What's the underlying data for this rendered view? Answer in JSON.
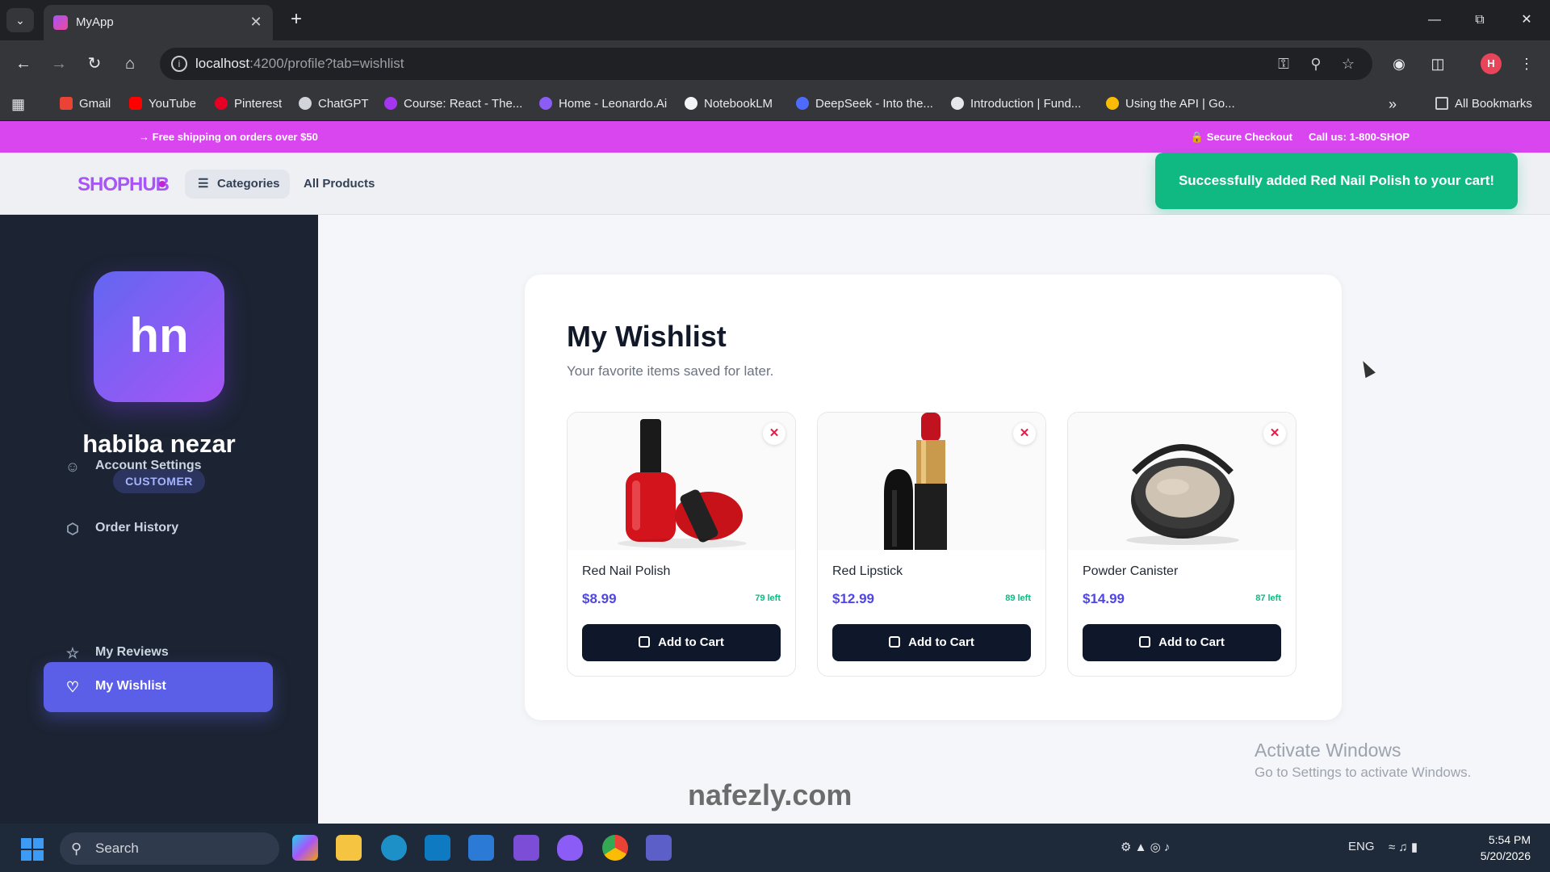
{
  "browser": {
    "tab_title": "MyApp",
    "new_tab": "+",
    "url_host": "localhost",
    "url_rest": ":4200/profile?tab=wishlist",
    "bookmarks": [
      "Gmail",
      "YouTube",
      "Pinterest",
      "ChatGPT",
      "Course: React - The...",
      "Home - Leonardo.Ai",
      "NotebookLM",
      "DeepSeek - Into the...",
      "Introduction | Fund...",
      "Using the API | Go..."
    ],
    "all_bookmarks": "All Bookmarks",
    "profile_initial": "H"
  },
  "promo": {
    "shipping": "Free shipping on orders over $50",
    "secure": "Secure Checkout",
    "call": "Call us: 1-800-SHOP"
  },
  "header": {
    "logo": "SHOPHUB",
    "categories": "Categories",
    "all_products": "All Products"
  },
  "toast": "Successfully added Red Nail Polish to your cart!",
  "profile": {
    "initials": "hn",
    "name": "habiba nezar",
    "role": "CUSTOMER",
    "nav": [
      {
        "label": "Account Settings",
        "icon": "user-icon"
      },
      {
        "label": "Order History",
        "icon": "box-icon"
      },
      {
        "label": "My Wishlist",
        "icon": "heart-icon",
        "active": true
      },
      {
        "label": "My Reviews",
        "icon": "star-icon"
      }
    ]
  },
  "wishlist": {
    "title": "My Wishlist",
    "subtitle": "Your favorite items saved for later.",
    "items": [
      {
        "name": "Red Nail Polish",
        "price": "$8.99",
        "stock": "79 left",
        "button": "Add to Cart"
      },
      {
        "name": "Red Lipstick",
        "price": "$12.99",
        "stock": "89 left",
        "button": "Add to Cart"
      },
      {
        "name": "Powder Canister",
        "price": "$14.99",
        "stock": "87 left",
        "button": "Add to Cart"
      }
    ]
  },
  "overlay": {
    "activate_title": "Activate Windows",
    "activate_sub": "Go to Settings to activate Windows.",
    "watermark": "nafezly.com"
  },
  "taskbar": {
    "search": "Search",
    "lang": "ENG",
    "time": "5:54 PM",
    "date": "5/20/2026"
  },
  "colors": {
    "promo": "#d946ef",
    "toast": "#10b981",
    "sidebar": "#1c2433",
    "accent": "#5b5fe8",
    "price": "#4f46e5"
  }
}
